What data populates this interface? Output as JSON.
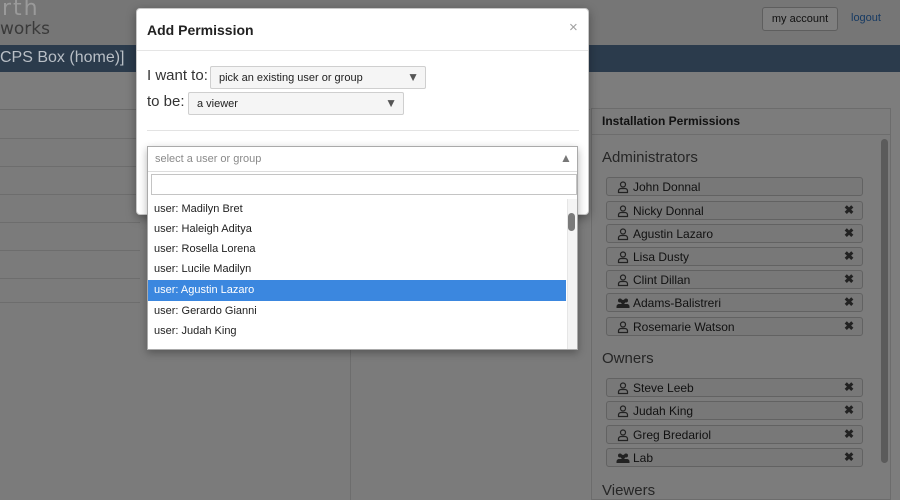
{
  "header": {
    "logo_line1": "rth",
    "logo_line2": "works",
    "my_account": "my account",
    "logout": "logout",
    "nav_title": "CPS Box (home)]"
  },
  "permissions_panel": {
    "title": "Installation Permissions",
    "sections": [
      {
        "title": "Administrators",
        "members": [
          {
            "icon": "user-icon",
            "name": "John Donnal",
            "removable": false
          },
          {
            "icon": "user-icon",
            "name": "Nicky Donnal",
            "removable": true
          },
          {
            "icon": "user-icon",
            "name": "Agustin Lazaro",
            "removable": true
          },
          {
            "icon": "user-icon",
            "name": "Lisa Dusty",
            "removable": true
          },
          {
            "icon": "user-icon",
            "name": "Clint Dillan",
            "removable": true
          },
          {
            "icon": "group-icon",
            "name": "Adams-Balistreri",
            "removable": true
          },
          {
            "icon": "user-icon",
            "name": "Rosemarie Watson",
            "removable": true
          }
        ]
      },
      {
        "title": "Owners",
        "members": [
          {
            "icon": "user-icon",
            "name": "Steve Leeb",
            "removable": true
          },
          {
            "icon": "user-icon",
            "name": "Judah King",
            "removable": true
          },
          {
            "icon": "user-icon",
            "name": "Greg Bredariol",
            "removable": true
          },
          {
            "icon": "group-icon",
            "name": "Lab",
            "removable": true
          }
        ]
      },
      {
        "title": "Viewers",
        "members": []
      }
    ],
    "remove_glyph": "✖"
  },
  "modal": {
    "title": "Add Permission",
    "close": "×",
    "want_label": "I want to:",
    "want_value": "pick an existing user or group",
    "role_label": "to be:",
    "role_value": "a viewer",
    "caret": "▼"
  },
  "picker": {
    "placeholder": "select a user or group",
    "caret": "▲",
    "search_value": "",
    "options": [
      "user: Madilyn Bret",
      "user: Haleigh Aditya",
      "user: Rosella Lorena",
      "user: Lucile Madilyn",
      "user: Agustin Lazaro",
      "user: Gerardo Gianni",
      "user: Judah King"
    ],
    "highlighted_index": 4
  }
}
